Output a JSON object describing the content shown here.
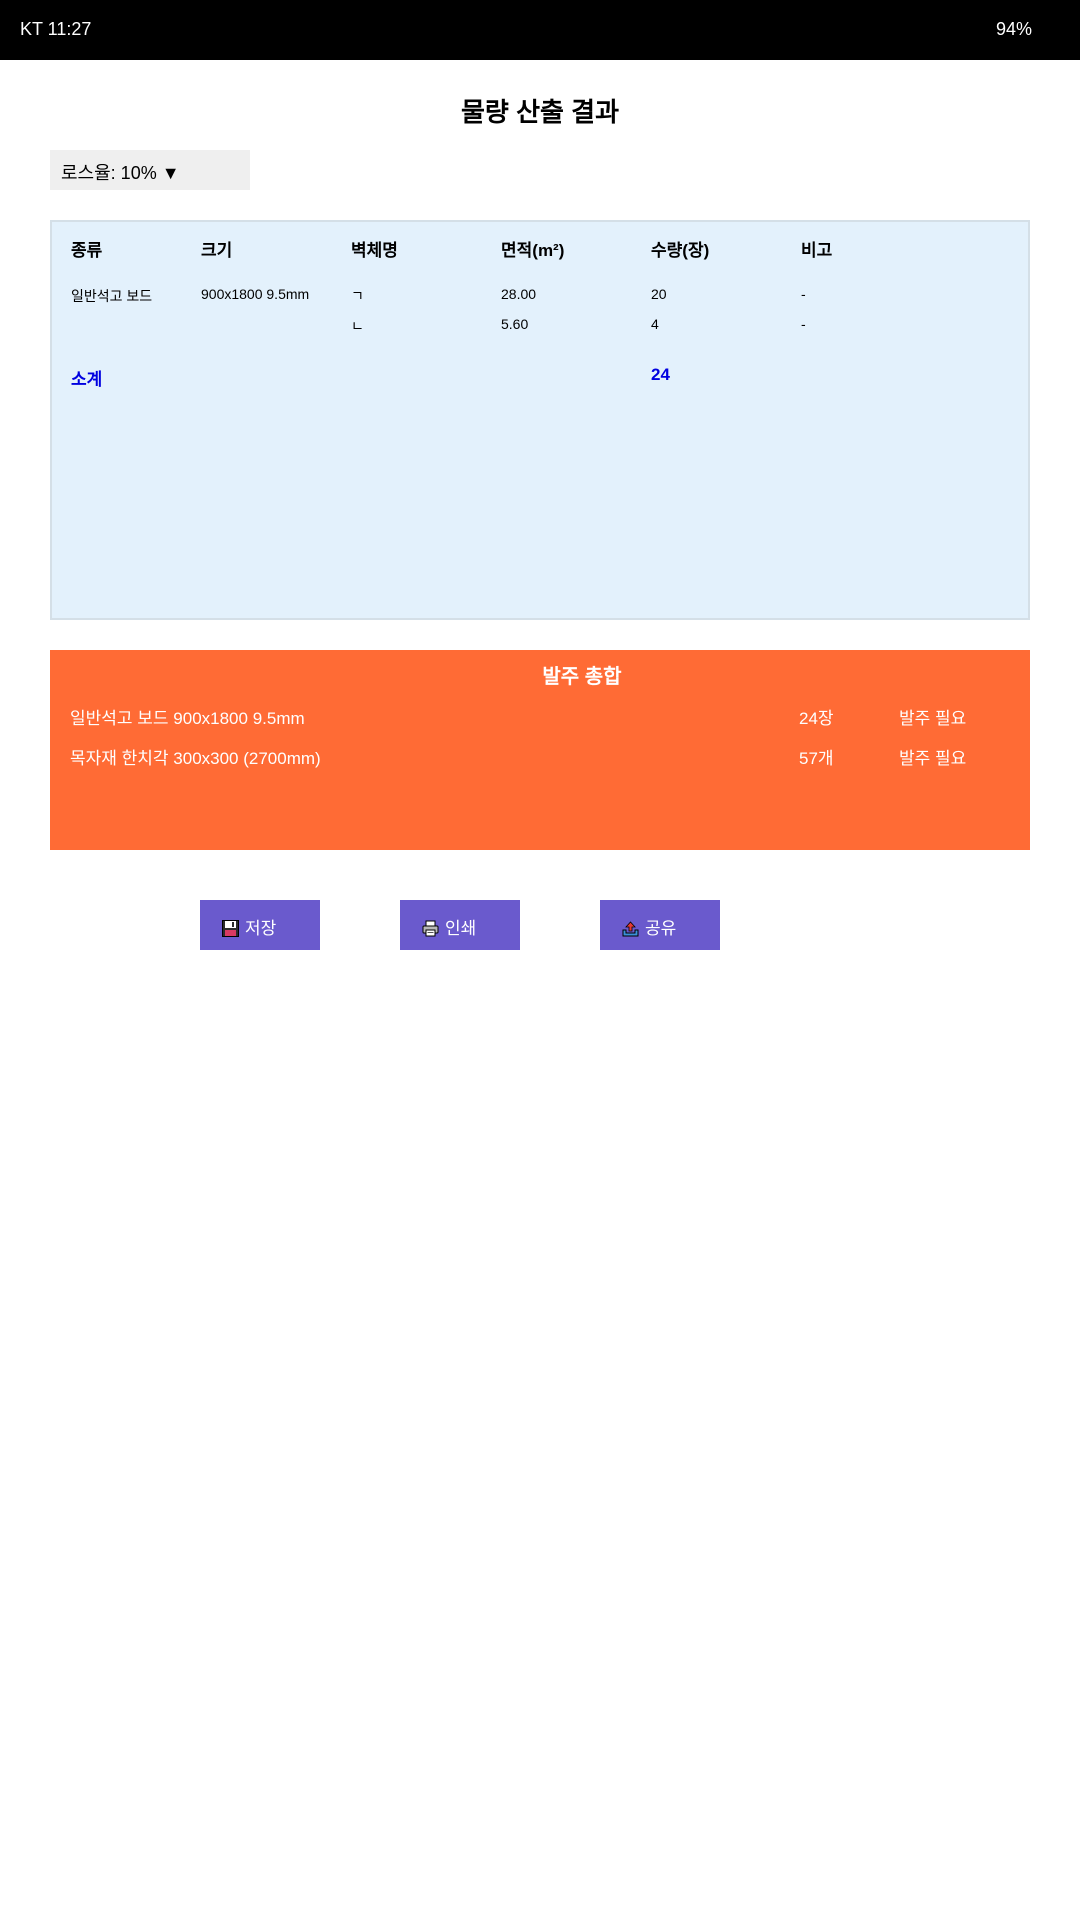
{
  "status_bar": {
    "carrier_time": "KT 11:27",
    "battery": "94%"
  },
  "page": {
    "title": "물량 산출 결과"
  },
  "loss_rate": {
    "label": "로스율: 10% ▼"
  },
  "quantity_table": {
    "headers": [
      "종류",
      "크기",
      "벽체명",
      "면적(m²)",
      "수량(장)",
      "비고"
    ],
    "rows": [
      {
        "type": "일반석고 보드",
        "size": "900x1800 9.5mm",
        "wall": "ㄱ",
        "area": "28.00",
        "qty": "20",
        "note": "-"
      },
      {
        "type": "",
        "size": "",
        "wall": "ㄴ",
        "area": "5.60",
        "qty": "4",
        "note": "-"
      }
    ],
    "subtotal_label": "소계",
    "subtotal_qty": "24"
  },
  "order_summary": {
    "title": "발주 총합",
    "items": [
      {
        "name": "일반석고 보드 900x1800 9.5mm",
        "qty": "24장",
        "status": "발주 필요"
      },
      {
        "name": "목자재 한치각 300x300 (2700mm)",
        "qty": "57개",
        "status": "발주 필요"
      }
    ]
  },
  "actions": {
    "save_label": "저장",
    "print_label": "인쇄",
    "share_label": "공유",
    "save_icon": "floppy-disk-icon",
    "print_icon": "printer-icon",
    "share_icon": "share-tray-icon"
  },
  "colors": {
    "table_bg": "#e3f1fc",
    "order_bg": "#ff6b35",
    "subtotal": "#0000e0",
    "button_bg": "#6a5acd"
  }
}
